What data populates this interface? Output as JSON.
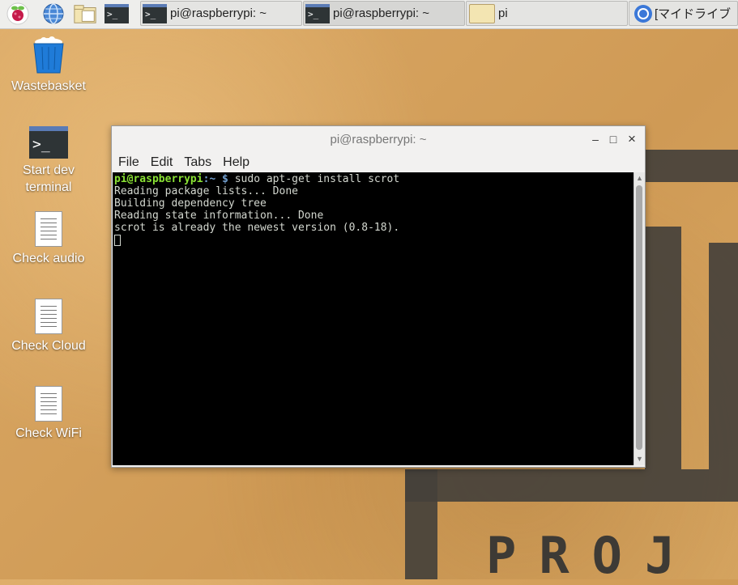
{
  "taskbar": {
    "launchers": [
      {
        "icon": "raspberry-menu-icon"
      },
      {
        "icon": "web-browser-icon"
      },
      {
        "icon": "file-manager-icon"
      },
      {
        "icon": "terminal-icon",
        "glyph": ">_"
      }
    ],
    "windows": [
      {
        "label": "pi@raspberrypi: ~",
        "icon": "terminal-icon",
        "glyph": ">_"
      },
      {
        "label": "pi@raspberrypi: ~",
        "icon": "terminal-icon",
        "glyph": ">_"
      },
      {
        "label": "pi",
        "icon": "folder-icon"
      },
      {
        "label": "[マイドライブ",
        "icon": "chromium-icon"
      }
    ]
  },
  "desktop": {
    "icons": [
      {
        "label": "Wastebasket",
        "icon": "wastebasket-icon"
      },
      {
        "label": "Start dev\nterminal",
        "line1": "Start dev",
        "line2": "terminal",
        "icon": "terminal-icon",
        "glyph": ">_"
      },
      {
        "label": "Check audio",
        "icon": "document-icon"
      },
      {
        "label": "Check Cloud",
        "icon": "document-icon"
      },
      {
        "label": "Check WiFi",
        "icon": "document-icon"
      }
    ]
  },
  "wallpaper": {
    "text": "PROJ"
  },
  "window": {
    "title": "pi@raspberrypi: ~",
    "controls": {
      "minimize": "–",
      "maximize": "□",
      "close": "×"
    },
    "menu": [
      "File",
      "Edit",
      "Tabs",
      "Help"
    ],
    "terminal": {
      "prompt_user": "pi@raspberrypi",
      "prompt_path": ":~ $",
      "command": " sudo apt-get install scrot",
      "output": [
        "Reading package lists... Done",
        "Building dependency tree",
        "Reading state information... Done",
        "scrot is already the newest version (0.8-18)."
      ]
    }
  },
  "colors": {
    "prompt_user": "#8ae234",
    "prompt_path": "#729fcf",
    "terminal_bg": "#000000"
  }
}
